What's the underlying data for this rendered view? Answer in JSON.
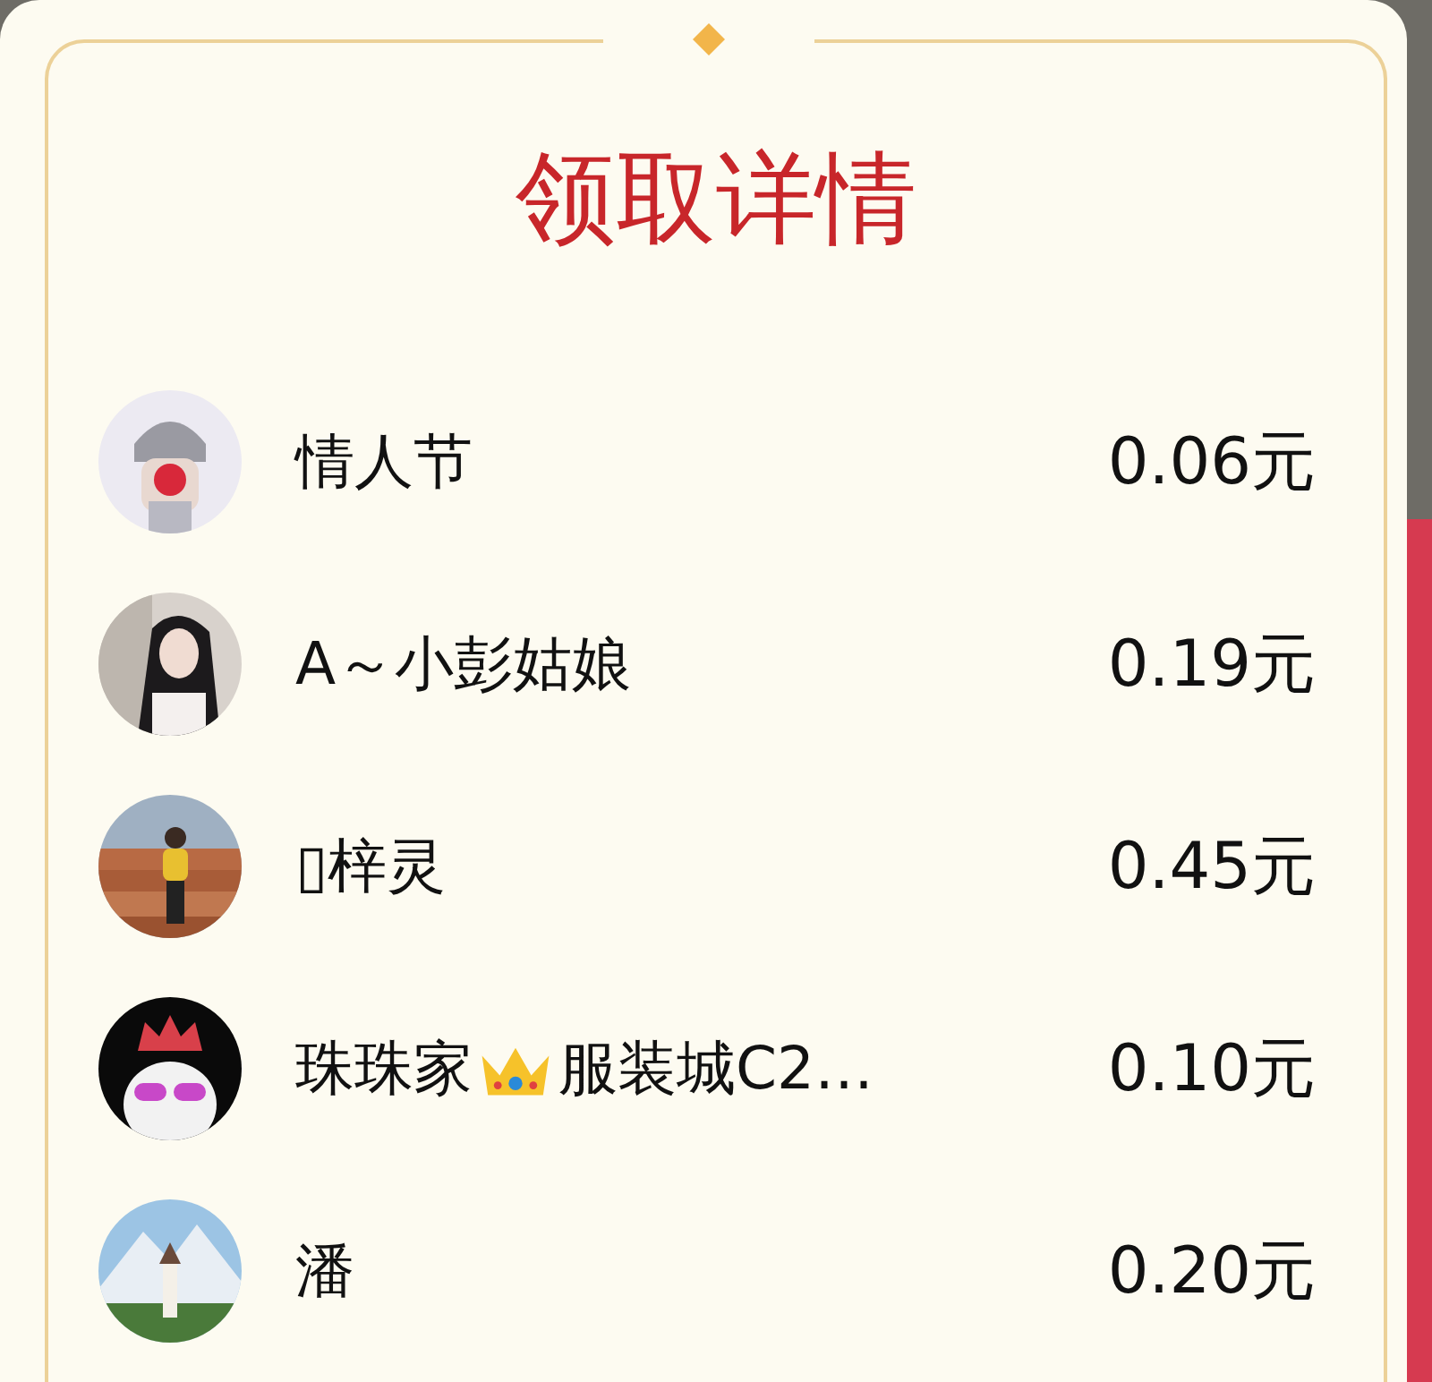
{
  "title": "领取详情",
  "records": [
    {
      "name": "情人节",
      "amount": "0.06元"
    },
    {
      "name": "A～小彭姑娘",
      "amount": "0.19元"
    },
    {
      "name": "▯梓灵",
      "amount": "0.45元"
    },
    {
      "name": "珠珠家",
      "name_continued": "服装城C2…",
      "has_crown": true,
      "amount": "0.10元"
    },
    {
      "name": "潘",
      "amount": "0.20元"
    }
  ]
}
